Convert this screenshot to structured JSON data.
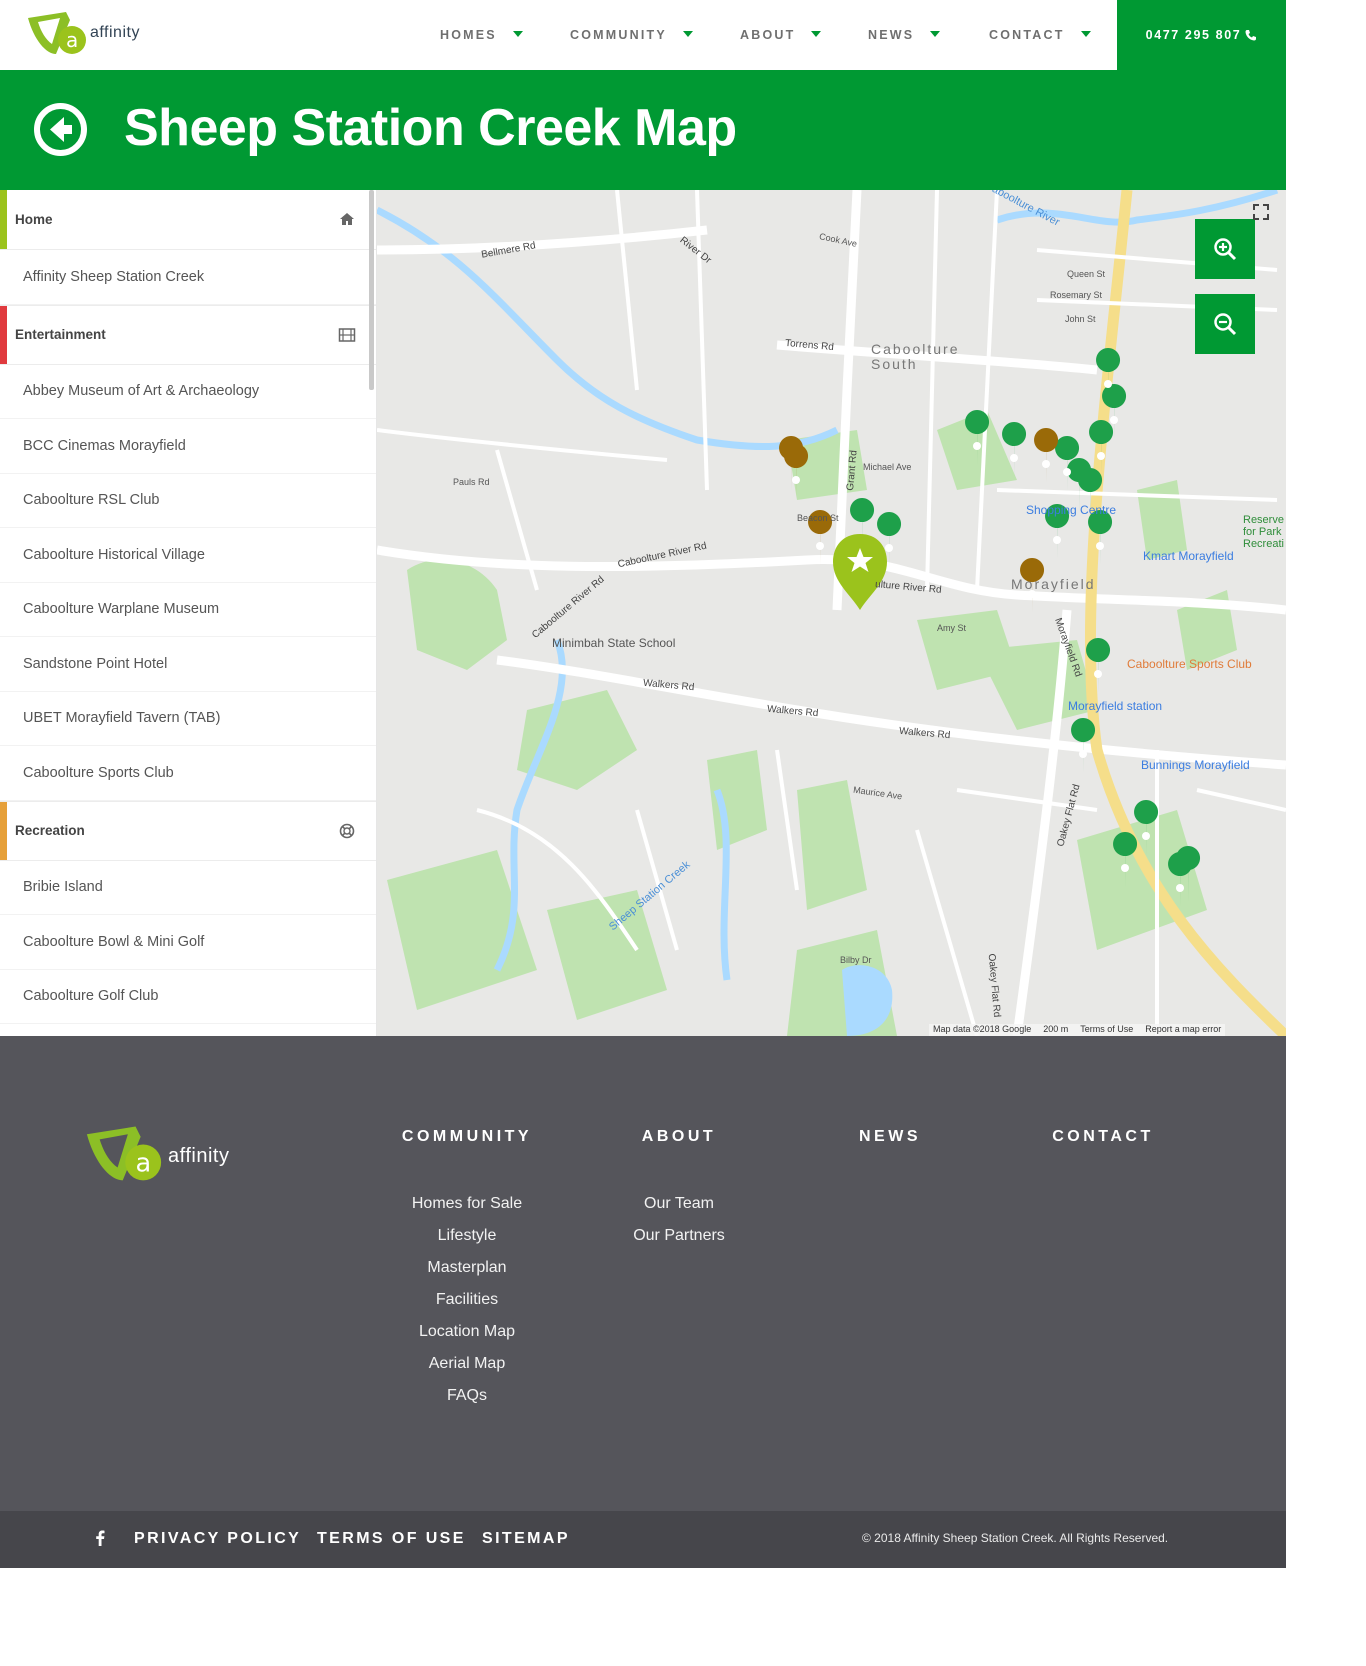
{
  "header": {
    "brand": "affinity",
    "nav": [
      {
        "label": "HOMES"
      },
      {
        "label": "COMMUNITY"
      },
      {
        "label": "ABOUT"
      },
      {
        "label": "NEWS"
      },
      {
        "label": "CONTACT"
      }
    ],
    "phone": "0477 295 807",
    "phone_icon": "phone-icon"
  },
  "banner": {
    "title": "Sheep Station Creek Map",
    "back_icon": "back-arrow-icon"
  },
  "sidebar": {
    "categories": [
      {
        "label": "Home",
        "color": "#9bc31c",
        "icon": "home-icon",
        "items": [
          "Affinity Sheep Station Creek"
        ]
      },
      {
        "label": "Entertainment",
        "color": "#e03a3e",
        "icon": "film-icon",
        "items": [
          "Abbey Museum of Art & Archaeology",
          "BCC Cinemas Morayfield",
          "Caboolture RSL Club",
          "Caboolture Historical Village",
          "Caboolture Warplane Museum",
          "Sandstone Point Hotel",
          "UBET Morayfield Tavern (TAB)",
          "Caboolture Sports Club"
        ]
      },
      {
        "label": "Recreation",
        "color": "#e6a03a",
        "icon": "lifebuoy-icon",
        "items": [
          "Bribie Island",
          "Caboolture Bowl & Mini Golf",
          "Caboolture Golf Club"
        ]
      }
    ]
  },
  "map": {
    "labels": {
      "caboolture_south": "Caboolture South",
      "morayfield": "Morayfield",
      "caboolture_river": "Caboolture River",
      "sheep_station_creek": "Sheep Station Creek",
      "minimbah": "Minimbah State School",
      "kmart": "Kmart Morayfield",
      "sports_club": "Caboolture Sports Club",
      "station": "Morayfield station",
      "bunnings": "Bunnings Morayfield",
      "shopping": "Shopping Centre",
      "reserve": "Reserve for Park Recreati",
      "walkers1": "Walkers Rd",
      "walkers2": "Walkers Rd",
      "walkers3": "Walkers Rd",
      "cab_river_rd": "Caboolture River Rd",
      "cab_river_rd2": "Caboolture River Rd",
      "cab_river_rd3": "ulture River Rd",
      "morayfield_rd": "Morayfield Rd",
      "torrens": "Torrens Rd",
      "grant": "Grant Rd",
      "bellmere": "Bellmere Rd",
      "river_dr": "River Dr",
      "oakey": "Oakey Flat Rd",
      "oakey2": "Oakey Flat Rd",
      "beacon": "Beacon St",
      "amy": "Amy St",
      "michael": "Michael Ave",
      "queen": "Queen St",
      "rosemary": "Rosemary St",
      "john": "John St",
      "cook": "Cook Ave",
      "pauls": "Pauls Rd",
      "bilby": "Bilby Dr",
      "maurice": "Maurice Ave"
    },
    "attribution": "Map data ©2018 Google",
    "scale": "200 m",
    "terms": "Terms of Use",
    "report": "Report a map error",
    "zoom_in_icon": "zoom-in-icon",
    "zoom_out_icon": "zoom-out-icon",
    "fullscreen_icon": "fullscreen-icon"
  },
  "footer": {
    "brand": "affinity",
    "columns": [
      {
        "title": "COMMUNITY",
        "links": [
          "Homes for Sale",
          "Lifestyle",
          "Masterplan",
          "Facilities",
          "Location Map",
          "Aerial Map",
          "FAQs"
        ]
      },
      {
        "title": "ABOUT",
        "links": [
          "Our Team",
          "Our Partners"
        ]
      },
      {
        "title": "NEWS",
        "links": []
      },
      {
        "title": "CONTACT",
        "links": []
      }
    ]
  },
  "bottom": {
    "facebook_icon": "facebook-icon",
    "links": [
      "PRIVACY POLICY",
      "TERMS OF USE",
      "SITEMAP"
    ],
    "copyright": "© 2018 Affinity Sheep Station Creek. All Rights Reserved."
  },
  "colors": {
    "brand_green": "#009933",
    "footer": "#55555b",
    "footer_bottom": "#46464b"
  }
}
